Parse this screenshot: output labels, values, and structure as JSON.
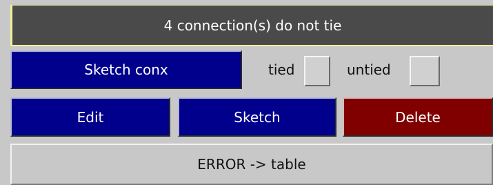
{
  "header": {
    "message": "4 connection(s) do not tie"
  },
  "row1": {
    "sketch_conx_label": "Sketch conx",
    "tied_label": "tied",
    "untied_label": "untied"
  },
  "row2": {
    "edit_label": "Edit",
    "sketch_label": "Sketch",
    "delete_label": "Delete"
  },
  "row3": {
    "error_table_label": "ERROR -> table"
  },
  "colors": {
    "header_bg": "#4a4a4a",
    "header_border": "#f3ef9b",
    "panel_bg": "#c8c8c8",
    "blue_button": "#00008c",
    "red_button": "#800000"
  }
}
